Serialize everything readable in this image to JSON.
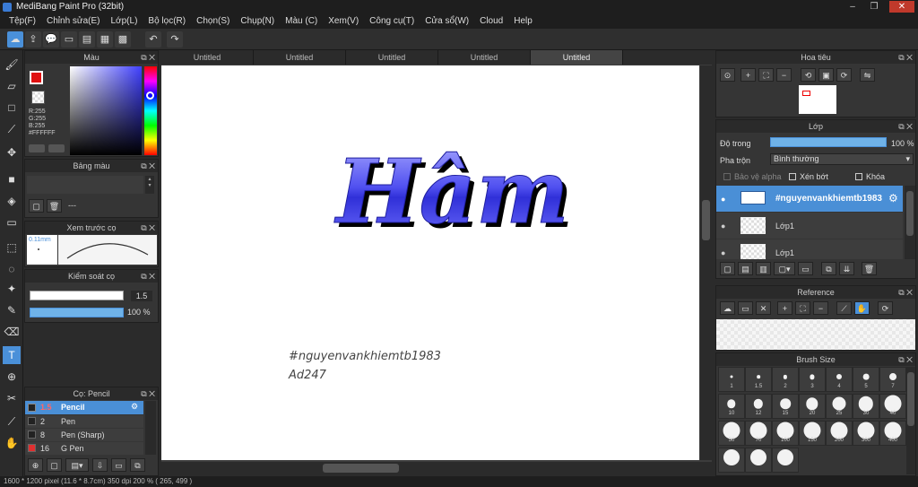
{
  "app": {
    "title": "MediBang Paint Pro (32bit)"
  },
  "menu": [
    "Tệp(F)",
    "Chỉnh sửa(E)",
    "Lớp(L)",
    "Bộ lọc(R)",
    "Chọn(S)",
    "Chụp(N)",
    "Màu (C)",
    "Xem(V)",
    "Công cụ(T)",
    "Cửa sổ(W)",
    "Cloud",
    "Help"
  ],
  "tabs": [
    "Untitled",
    "Untitled",
    "Untitled",
    "Untitled",
    "Untitled"
  ],
  "color_panel": {
    "title": "Màu",
    "r": "R:255",
    "g": "G:255",
    "b": "B:255",
    "hex": "#FFFFFF"
  },
  "palette_panel": {
    "title": "Bảng màu",
    "dash": "---"
  },
  "brush_preview": {
    "title": "Xem trước cọ",
    "size": "0.11mm"
  },
  "brush_control": {
    "title": "Kiểm soát cọ",
    "size_value": "1.5",
    "opacity_value": "100 %"
  },
  "brush_list": {
    "title": "Cọ: Pencil",
    "items": [
      {
        "size": "1.5",
        "name": "Pencil",
        "swatch": "#222222"
      },
      {
        "size": "2",
        "name": "Pen",
        "swatch": "#222222"
      },
      {
        "size": "8",
        "name": "Pen (Sharp)",
        "swatch": "#222222"
      },
      {
        "size": "16",
        "name": "G Pen",
        "swatch": "#e03030"
      }
    ]
  },
  "navigator": {
    "title": "Hoa tiêu"
  },
  "layer_panel": {
    "title": "Lớp",
    "opacity_label": "Độ trong",
    "opacity_value": "100 %",
    "blend_label": "Pha trộn",
    "blend_value": "Bình thường",
    "protect_alpha": "Bảo vệ alpha",
    "clipping": "Xén bớt",
    "lock": "Khóa",
    "layers": [
      {
        "name": "#nguyenvankhiemtb1983"
      },
      {
        "name": "Lớp1"
      },
      {
        "name": "Lớp1"
      }
    ]
  },
  "reference_panel": {
    "title": "Reference"
  },
  "brush_size_panel": {
    "title": "Brush Size",
    "sizes": [
      "1",
      "1.5",
      "2",
      "3",
      "4",
      "5",
      "7",
      "10",
      "12",
      "15",
      "20",
      "25",
      "30",
      "40",
      "50",
      "70",
      "100",
      "150",
      "200",
      "300",
      "400",
      "",
      "",
      ""
    ]
  },
  "canvas": {
    "title_text": "Hâm",
    "signature_line1": "#nguyenvankhiemtb1983",
    "signature_line2": "Ad247"
  },
  "status": {
    "text": "1600 * 1200 pixel   (11.6 * 8.7cm)   350 dpi   200 %   ( 265, 499 )"
  },
  "colors": {
    "accent": "#4a90d9",
    "layer_selected": "#4a8fd6",
    "hue_blue": "#3a3adf"
  }
}
